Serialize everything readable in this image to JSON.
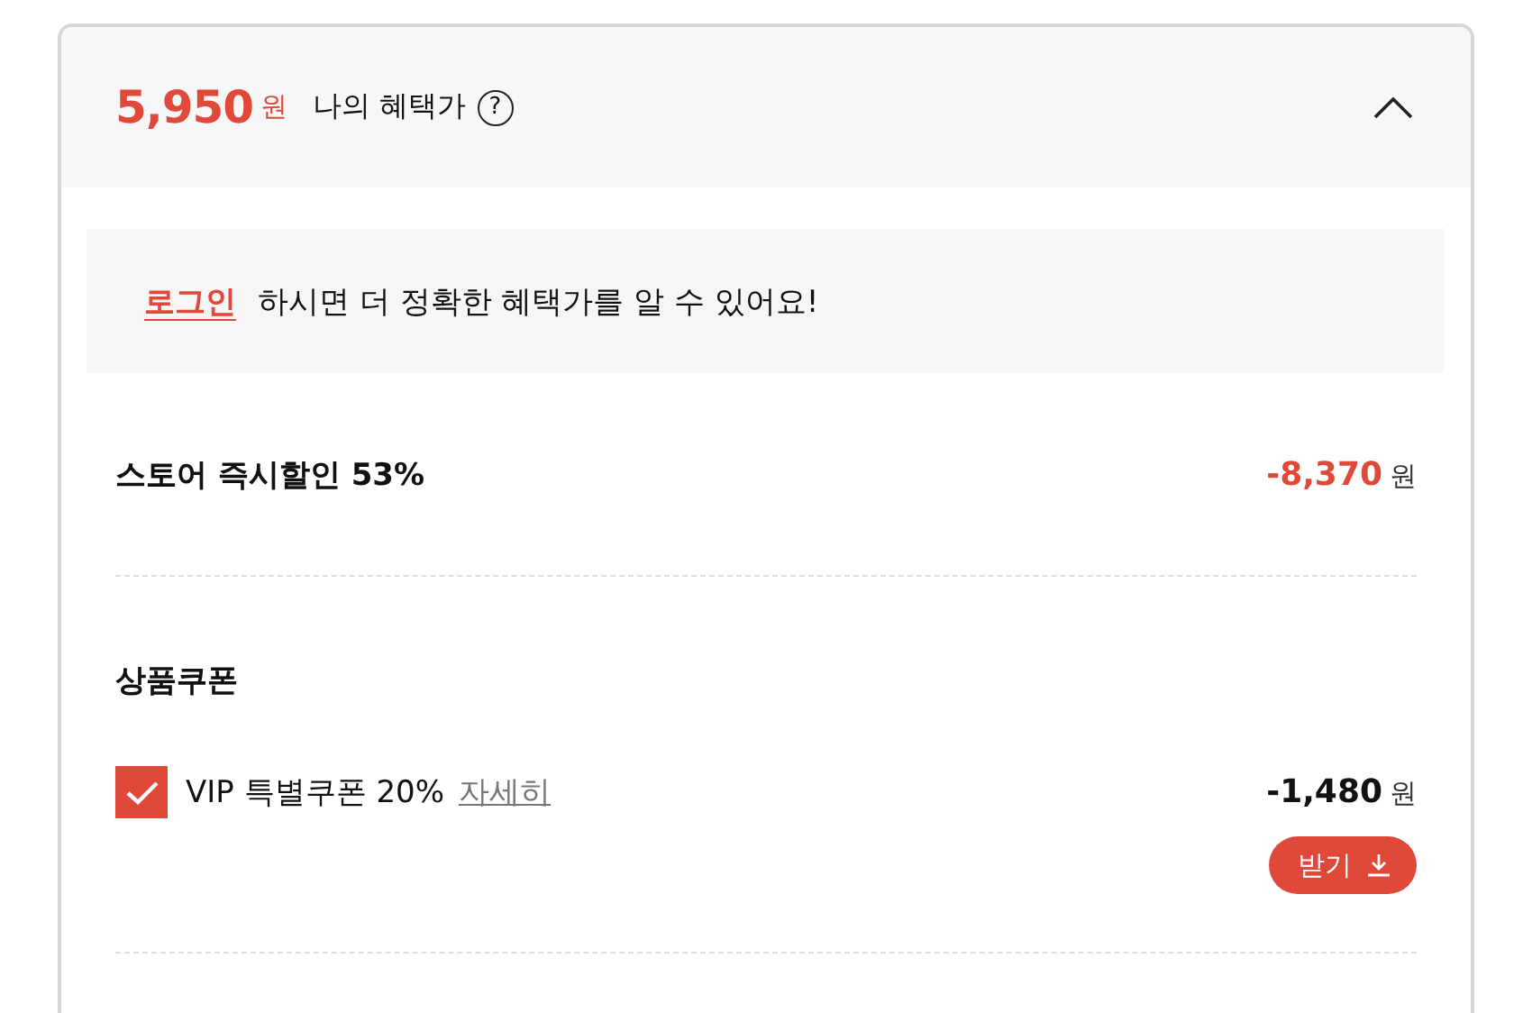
{
  "header": {
    "price": "5,950",
    "unit": "원",
    "label": "나의 혜택가",
    "help": "?",
    "expanded": true
  },
  "login_notice": {
    "link": "로그인",
    "text": "하시면 더 정확한 혜택가를 알 수 있어요!"
  },
  "store_discount": {
    "label": "스토어 즉시할인 53%",
    "amount": "-8,370",
    "unit": "원"
  },
  "coupon_section": {
    "title": "상품쿠폰",
    "coupons": [
      {
        "label": "VIP 특별쿠폰 20%",
        "details": "자세히",
        "checked": true,
        "amount": "-1,480",
        "unit": "원",
        "button": "받기"
      }
    ]
  }
}
